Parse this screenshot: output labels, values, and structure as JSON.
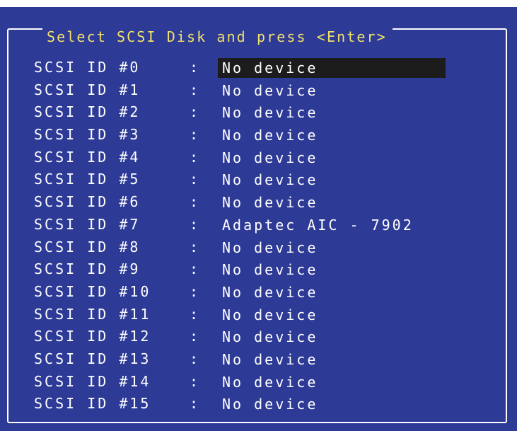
{
  "screen": {
    "title": "Select SCSI Disk and press <Enter>",
    "separator": ":",
    "selected_index": 0,
    "devices": [
      {
        "label": "SCSI ID #0",
        "value": "No device"
      },
      {
        "label": "SCSI ID #1",
        "value": "No device"
      },
      {
        "label": "SCSI ID #2",
        "value": "No device"
      },
      {
        "label": "SCSI ID #3",
        "value": "No device"
      },
      {
        "label": "SCSI ID #4",
        "value": "No device"
      },
      {
        "label": "SCSI ID #5",
        "value": "No device"
      },
      {
        "label": "SCSI ID #6",
        "value": "No device"
      },
      {
        "label": "SCSI ID #7",
        "value": "Adaptec AIC - 7902"
      },
      {
        "label": "SCSI ID #8",
        "value": "No device"
      },
      {
        "label": "SCSI ID #9",
        "value": "No device"
      },
      {
        "label": "SCSI ID #10",
        "value": "No device"
      },
      {
        "label": "SCSI ID #11",
        "value": "No device"
      },
      {
        "label": "SCSI ID #12",
        "value": "No device"
      },
      {
        "label": "SCSI ID #13",
        "value": "No device"
      },
      {
        "label": "SCSI ID #14",
        "value": "No device"
      },
      {
        "label": "SCSI ID #15",
        "value": "No device"
      }
    ]
  },
  "colors": {
    "background": "#2d3a96",
    "title_text": "#f2e06a",
    "text": "#ffffff",
    "highlight": "#1c1c1c"
  }
}
